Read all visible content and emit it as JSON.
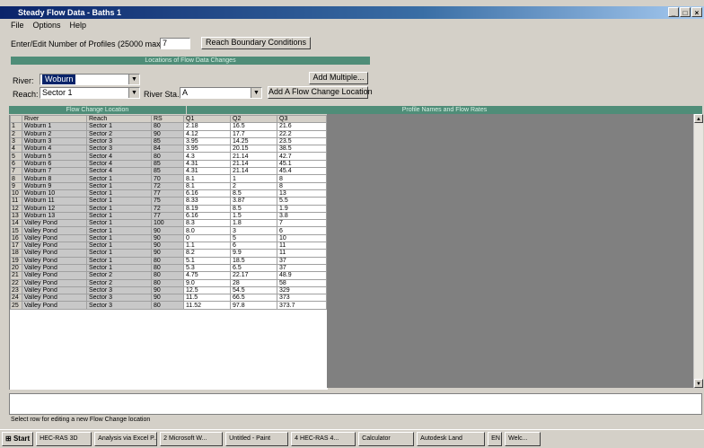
{
  "window": {
    "title": "Steady Flow Data - Baths 1"
  },
  "menu": [
    "File",
    "Options",
    "Help"
  ],
  "profiles": {
    "label": "Enter/Edit Number of Profiles (25000 max):",
    "value": "7",
    "reach_button": "Reach Boundary Conditions"
  },
  "locations": {
    "header": "Locations of Flow Data Changes",
    "river_label": "River:",
    "river_value": "Woburn",
    "reach_label": "Reach:",
    "reach_value": "Sector 1",
    "river_sta_label": "River Sta.:",
    "river_sta_value": "A",
    "add_multiple": "Add Multiple...",
    "add_location": "Add A Flow Change Location"
  },
  "table": {
    "left_header": "Flow Change Location",
    "right_header": "Profile Names and Flow Rates",
    "columns": [
      "River",
      "Reach",
      "RS",
      "Q1",
      "Q2",
      "Q3"
    ],
    "rows": [
      [
        "1",
        "Woburn 1",
        "Sector 1",
        "80",
        "2.18",
        "16.5",
        "21.6"
      ],
      [
        "2",
        "Woburn 2",
        "Sector 2",
        "90",
        "4.12",
        "17.7",
        "22.2"
      ],
      [
        "3",
        "Woburn 3",
        "Sector 3",
        "85",
        "3.95",
        "14.25",
        "23.5"
      ],
      [
        "4",
        "Woburn 4",
        "Sector 3",
        "84",
        "3.95",
        "20.15",
        "38.5"
      ],
      [
        "5",
        "Woburn 5",
        "Sector 4",
        "80",
        "4.3",
        "21.14",
        "42.7"
      ],
      [
        "6",
        "Woburn 6",
        "Sector 4",
        "85",
        "4.31",
        "21.14",
        "45.1"
      ],
      [
        "7",
        "Woburn 7",
        "Sector 4",
        "85",
        "4.31",
        "21.14",
        "45.4"
      ],
      [
        "8",
        "Woburn 8",
        "Sector 1",
        "70",
        "8.1",
        "1",
        "8"
      ],
      [
        "9",
        "Woburn 9",
        "Sector 1",
        "72",
        "8.1",
        "2",
        "8"
      ],
      [
        "10",
        "Woburn 10",
        "Sector 1",
        "77",
        "6.16",
        "8.5",
        "13"
      ],
      [
        "11",
        "Woburn 11",
        "Sector 1",
        "75",
        "8.33",
        "3.87",
        "5.5"
      ],
      [
        "12",
        "Woburn 12",
        "Sector 1",
        "72",
        "8.19",
        "8.5",
        "1.9"
      ],
      [
        "13",
        "Woburn 13",
        "Sector 1",
        "77",
        "6.16",
        "1.5",
        "3.8"
      ],
      [
        "14",
        "Valley Pond",
        "Sector 1",
        "100",
        "8.3",
        "1.8",
        "7"
      ],
      [
        "15",
        "Valley Pond",
        "Sector 1",
        "90",
        "8.0",
        "3",
        "6"
      ],
      [
        "16",
        "Valley Pond",
        "Sector 1",
        "90",
        "0",
        "5",
        "10"
      ],
      [
        "17",
        "Valley Pond",
        "Sector 1",
        "90",
        "1.1",
        "6",
        "11"
      ],
      [
        "18",
        "Valley Pond",
        "Sector 1",
        "90",
        "8.2",
        "9.9",
        "11"
      ],
      [
        "19",
        "Valley Pond",
        "Sector 1",
        "80",
        "5.1",
        "18.5",
        "37"
      ],
      [
        "20",
        "Valley Pond",
        "Sector 1",
        "80",
        "5.3",
        "6.5",
        "37"
      ],
      [
        "21",
        "Valley Pond",
        "Sector 2",
        "80",
        "4.75",
        "22.17",
        "48.9"
      ],
      [
        "22",
        "Valley Pond",
        "Sector 2",
        "80",
        "9.0",
        "28",
        "58"
      ],
      [
        "23",
        "Valley Pond",
        "Sector 3",
        "90",
        "12.5",
        "54.5",
        "329"
      ],
      [
        "24",
        "Valley Pond",
        "Sector 3",
        "90",
        "11.5",
        "66.5",
        "373"
      ],
      [
        "25",
        "Valley Pond",
        "Sector 3",
        "80",
        "11.52",
        "97.8",
        "373.7"
      ]
    ]
  },
  "status_text": "Select row for editing a new Flow Change location",
  "taskbar": {
    "start": "Start",
    "items": [
      "HEC-RAS 3D",
      "Analysis via Excel P...",
      "2 Microsoft W...",
      "Untitled - Paint",
      "4 HEC-RAS 4...",
      "Calculator",
      "Autodesk Land",
      "Welc..."
    ],
    "lang": "EN"
  }
}
